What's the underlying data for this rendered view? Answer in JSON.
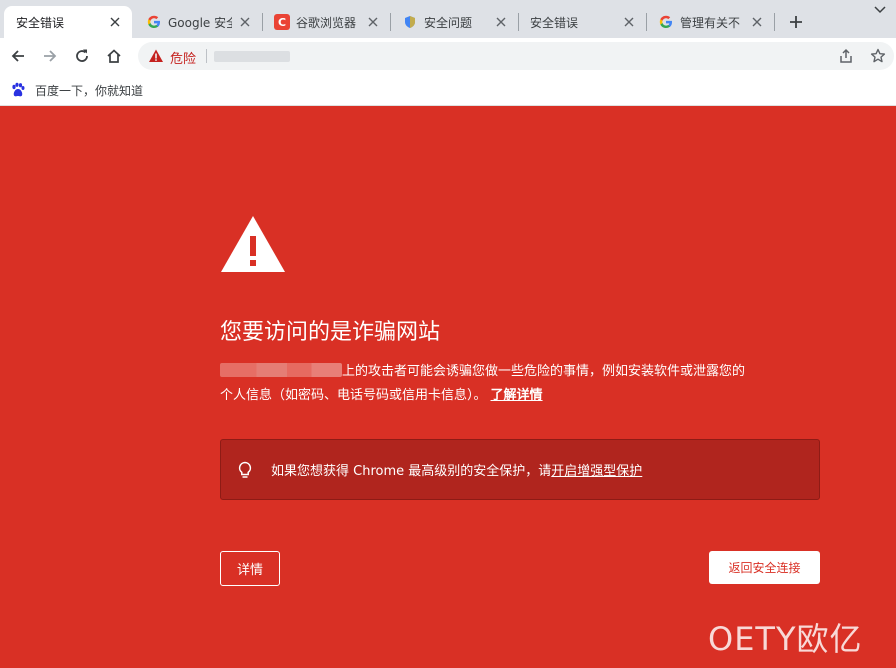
{
  "colors": {
    "danger_red": "#d93025",
    "box_red": "#b0251e",
    "tab_bar": "#dee1e6",
    "omnibox": "#f1f3f4"
  },
  "tabs": [
    {
      "title": "安全错误",
      "favicon": "none",
      "active": true
    },
    {
      "title": "Google 安全",
      "favicon": "google-icon",
      "active": false
    },
    {
      "title": "谷歌浏览器",
      "favicon": "c-logo-icon",
      "active": false
    },
    {
      "title": "安全问题",
      "favicon": "shield-icon",
      "active": false
    },
    {
      "title": "安全错误",
      "favicon": "none",
      "active": false
    },
    {
      "title": "管理有关不",
      "favicon": "google-icon",
      "active": false
    }
  ],
  "omnibox": {
    "security_label": "危险"
  },
  "bookmarks": [
    {
      "label": "百度一下，你就知道",
      "icon": "baidu-paw-icon"
    }
  ],
  "page": {
    "headline": "您要访问的是诈骗网站",
    "para_line1": "上的攻击者可能会诱骗您做一些危险的事情，例如安装软件或泄露您的",
    "para_line2": "个人信息（如密码、电话号码或信用卡信息）。",
    "learn_more": "了解详情",
    "enhanced_text": "如果您想获得 Chrome 最高级别的安全保护，请",
    "enhanced_link": "开启增强型保护",
    "details_button": "详情",
    "back_button": "返回安全连接"
  },
  "watermark": "OETY欧亿"
}
